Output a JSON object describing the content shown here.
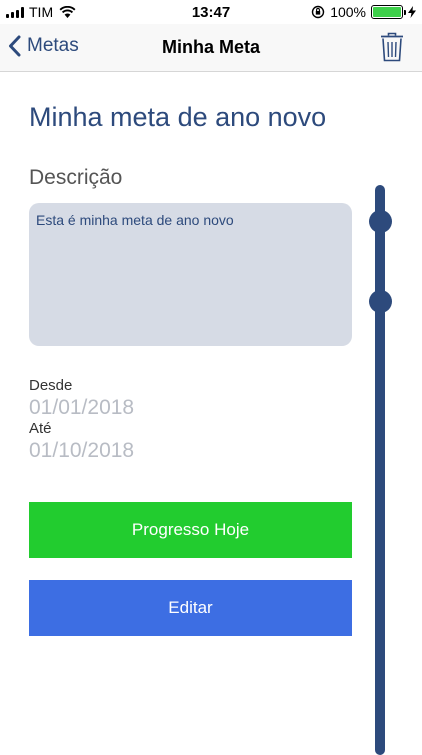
{
  "status": {
    "carrier": "TIM",
    "time": "13:47",
    "battery": "100%"
  },
  "nav": {
    "back_label": "Metas",
    "title": "Minha Meta"
  },
  "goal": {
    "title": "Minha meta de ano novo",
    "description_label": "Descrição",
    "description": "Esta é minha meta de ano novo",
    "since_label": "Desde",
    "since_date": "01/01/2018",
    "until_label": "Até",
    "until_date": "01/10/2018"
  },
  "buttons": {
    "progress_today": "Progresso Hoje",
    "edit": "Editar"
  },
  "colors": {
    "brand": "#2d4a7c",
    "progress_button": "#22cc2f",
    "edit_button": "#3d6ee3",
    "description_bg": "#d6dbe5"
  },
  "icons": {
    "back": "chevron-left-icon",
    "delete": "trash-icon",
    "wifi": "wifi-icon",
    "orientation_lock": "orientation-lock-icon",
    "charging": "bolt-icon"
  }
}
